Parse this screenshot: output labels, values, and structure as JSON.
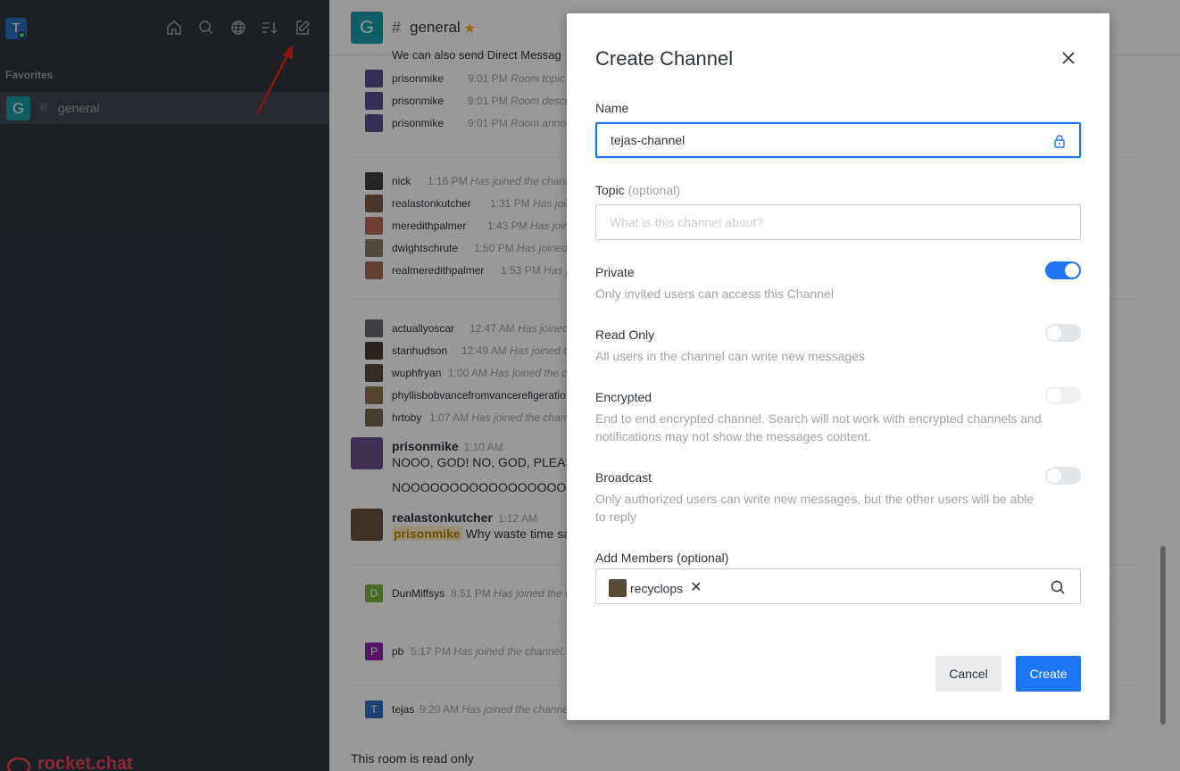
{
  "sidebar": {
    "user_initial": "T",
    "section_title": "Favorites",
    "favorites": [
      {
        "initial": "G",
        "label": "general"
      }
    ],
    "footer_brand": "rocket.chat",
    "icons": [
      "home-icon",
      "search-icon",
      "directory-icon",
      "sort-icon",
      "create-new-icon"
    ]
  },
  "room": {
    "initial": "G",
    "name": "general",
    "truncated_top": "We can also send Direct Messag",
    "system_messages": [
      {
        "user": "prisonmike",
        "time": "9:01 PM",
        "text": "Room topic cha"
      },
      {
        "user": "prisonmike",
        "time": "9:01 PM",
        "text": "Room descripti"
      },
      {
        "user": "prisonmike",
        "time": "9:01 PM",
        "text": "Room announc"
      },
      {
        "user": "nick",
        "time": "1:16 PM",
        "text": "Has joined the channel"
      },
      {
        "user": "realastonkutcher",
        "time": "1:31 PM",
        "text": "Has joine"
      },
      {
        "user": "meredithpalmer",
        "time": "1:43 PM",
        "text": "Has joined"
      },
      {
        "user": "dwightschrute",
        "time": "1:50 PM",
        "text": "Has joined t"
      },
      {
        "user": "realmeredithpalmer",
        "time": "1:53 PM",
        "text": "Has jo"
      },
      {
        "user": "actuallyoscar",
        "time": "12:47 AM",
        "text": "Has joined t"
      },
      {
        "user": "stanhudson",
        "time": "12:49 AM",
        "text": "Has joined th"
      },
      {
        "user": "wuphfryan",
        "time": "1:00 AM",
        "text": "Has joined the c"
      },
      {
        "user": "phyllisbobvancefromvancerefigeratio",
        "time": "",
        "text": ""
      },
      {
        "user": "hrtoby",
        "time": "1:07 AM",
        "text": "Has joined the chan"
      }
    ],
    "messages": [
      {
        "user": "prisonmike",
        "time": "1:10 AM",
        "line1": "NOOO, GOD! NO, GOD, PLEASE",
        "line2": "NOOOOOOOOOOOOOOOOOO"
      },
      {
        "user": "realastonkutcher",
        "time": "1:12 AM",
        "mention": "prisonmike",
        "line1": "Why waste time sa"
      }
    ],
    "late_joins": [
      {
        "initial": "D",
        "user": "DunMiffsys",
        "time": "8:51 PM",
        "text": "Has joined the c"
      },
      {
        "initial": "P",
        "user": "pb",
        "time": "5:17 PM",
        "text": "Has joined the channel."
      },
      {
        "initial": "T",
        "user": "tejas",
        "time": "9:20 AM",
        "text": "Has joined the channe"
      }
    ],
    "readonly_notice": "This room is read only"
  },
  "modal": {
    "title": "Create Channel",
    "name_label": "Name",
    "name_value": "tejas-channel",
    "topic_label": "Topic",
    "topic_optional": "(optional)",
    "topic_placeholder": "What is this channel about?",
    "private_title": "Private",
    "private_desc": "Only invited users can access this Channel",
    "private_on": true,
    "readonly_title": "Read Only",
    "readonly_desc": "All users in the channel can write new messages",
    "readonly_on": false,
    "encrypted_title": "Encrypted",
    "encrypted_desc": "End to end encrypted channel. Search will not work with encrypted channels and notifications may not show the messages content.",
    "encrypted_on": false,
    "broadcast_title": "Broadcast",
    "broadcast_desc": "Only authorized users can write new messages, but the other users will be able to reply",
    "broadcast_on": false,
    "members_label": "Add Members (optional)",
    "members": [
      "recyclops"
    ],
    "cancel_label": "Cancel",
    "create_label": "Create"
  },
  "colors": {
    "accent": "#1d74f5",
    "sidebar_bg": "#2f343d",
    "brand_red": "#e9445a"
  }
}
